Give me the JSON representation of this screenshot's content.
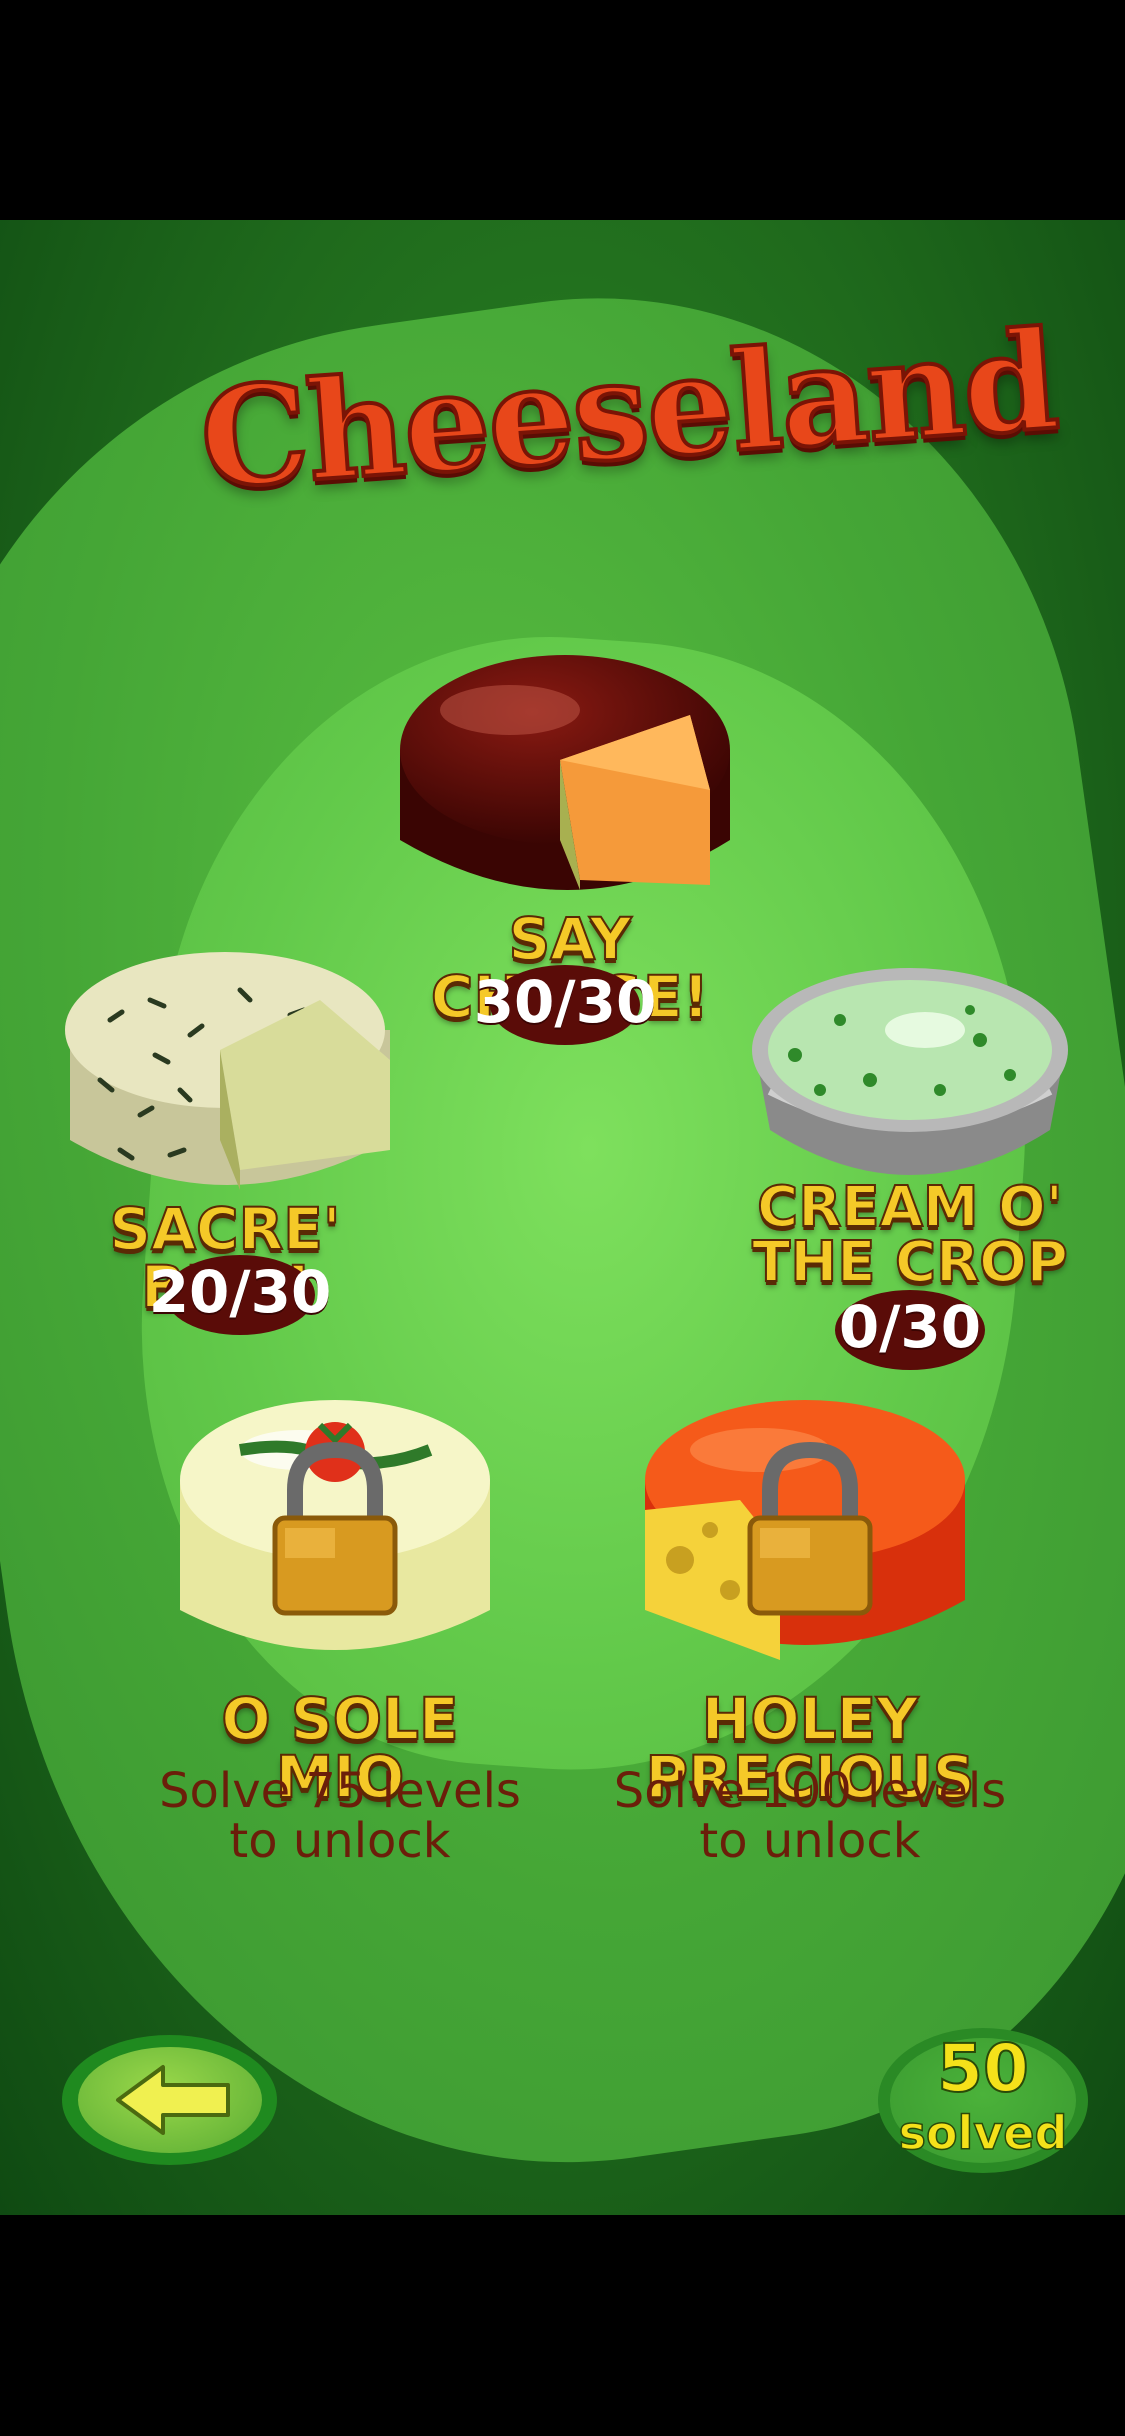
{
  "status_bar": {
    "time": ""
  },
  "title": "Cheeseland",
  "packs": [
    {
      "name": "SAY CHEESE!",
      "progress": "30/30",
      "locked": false
    },
    {
      "name": "SACRE' BLEU",
      "progress": "20/30",
      "locked": false
    },
    {
      "name_line1": "CREAM O'",
      "name_line2": "THE CROP",
      "progress": "0/30",
      "locked": false
    },
    {
      "name": "O SOLE MIO",
      "lock_line1": "Solve 75 levels",
      "lock_line2": "to unlock",
      "locked": true
    },
    {
      "name": "HOLEY PRECIOUS",
      "lock_line1": "Solve 100 levels",
      "lock_line2": "to unlock",
      "locked": true
    }
  ],
  "footer": {
    "solved_count": "50",
    "solved_label": "solved"
  },
  "colors": {
    "title": "#e8471a",
    "label": "#f5c928",
    "background": "#2f8b26"
  }
}
